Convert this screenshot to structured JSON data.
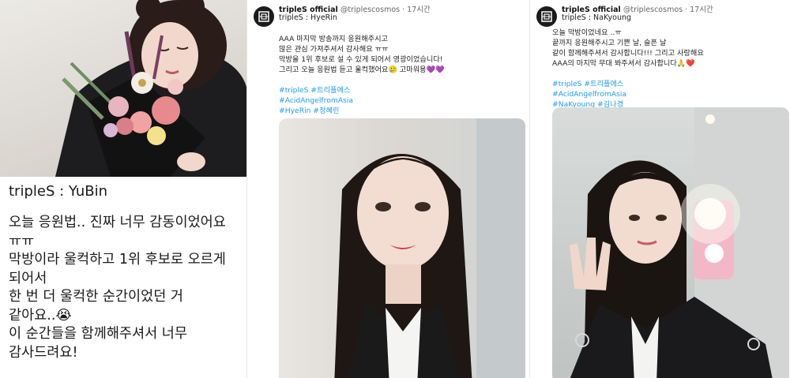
{
  "panel1": {
    "title": "tripleS : YuBin",
    "lines": [
      "오늘 응원법.. 진짜 너무 감동이었어요",
      "ㅠㅠ",
      "막방이라 울컥하고 1위 후보로 오르게",
      "되어서",
      "한 번 더 울컥한 순간이었던 거",
      "같아요..😭",
      "이 순간들을 함께해주셔서 너무",
      "감사드려요!"
    ]
  },
  "tweet1": {
    "name": "tripleS official",
    "handle": "@triplescosmos",
    "time": "· 17시간",
    "subtitle": "tripleS : HyeRin",
    "lines": [
      "AAA 마지막 방송까지 응원해주시고",
      "많은 관심 가져주셔서 감사해요 ㅠㅠ",
      "막방을 1위 후보로 설 수 있게 되어서 영광이었습니다!",
      "그리고 오늘 응원법 듣고 울컥했어요🥲 고마워용💜💜"
    ],
    "hashtags": [
      "#tripleS #트리플에스",
      "#AcidAngelfromAsia",
      "#HyeRin #정혜린"
    ]
  },
  "tweet2": {
    "name": "tripleS official",
    "handle": "@triplescosmos",
    "time": "· 17시간",
    "subtitle": "tripleS : NaKyoung",
    "lines": [
      "오늘 막방이었네요 ..ㅠ",
      "끝까지 응원해주시고 기쁜 날, 슬픈 날",
      "같이 함께해주셔서 감사합니다!!! 그리고 사랑해요",
      "AAA의 마지막 무대 봐주셔서 감사합니다🙏❤️"
    ],
    "hashtags": [
      "#tripleS #트리플에스",
      "#AcidAngelfromAsia",
      "#NaKyoung #김나경"
    ]
  },
  "colors": {
    "hashtag": "#1d9bf0",
    "avatar": "#1b1b1b"
  }
}
